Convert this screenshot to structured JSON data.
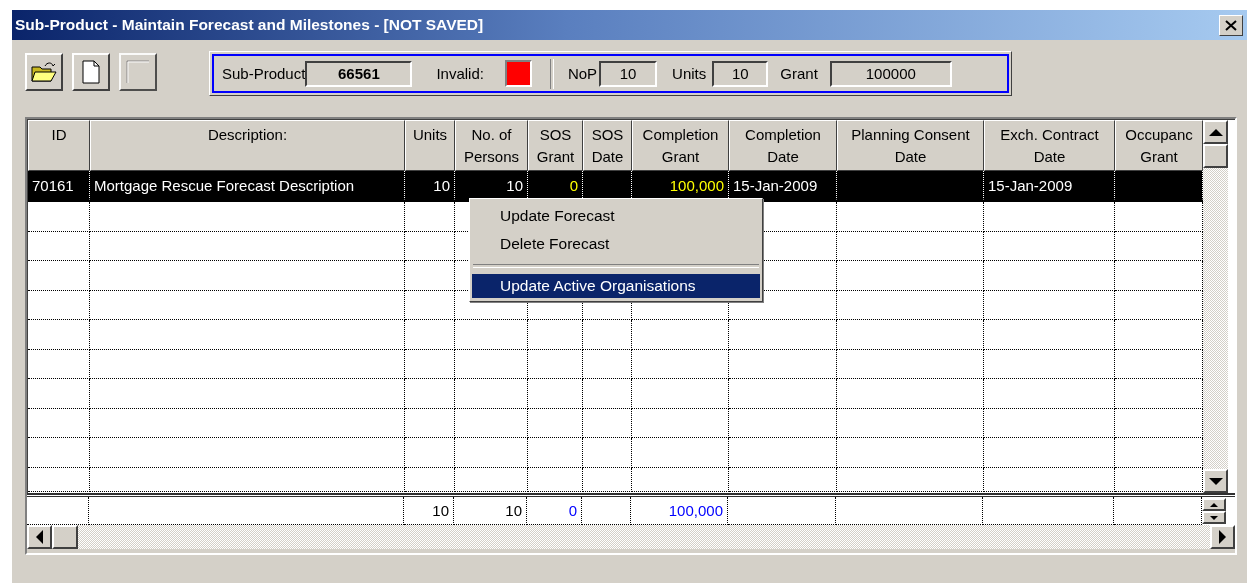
{
  "window": {
    "title": "Sub-Product - Maintain Forecast and Milestones - [NOT SAVED]"
  },
  "toolbar": [
    {
      "kind": "open",
      "disabled": false
    },
    {
      "kind": "new",
      "disabled": false
    },
    {
      "kind": "blank",
      "disabled": true
    }
  ],
  "summary": {
    "sub_product": {
      "label": "Sub-Product",
      "value": "66561"
    },
    "invalid": {
      "label": "Invalid:",
      "color": "#ff0000"
    },
    "nop": {
      "label": "NoP",
      "value": "10"
    },
    "units": {
      "label": "Units",
      "value": "10"
    },
    "grant": {
      "label": "Grant",
      "value": "100000"
    }
  },
  "table": {
    "columns": [
      {
        "label": "ID"
      },
      {
        "label": "Description:"
      },
      {
        "label": "Units"
      },
      {
        "label": "No. of Persons"
      },
      {
        "label": "SOS Grant"
      },
      {
        "label": "SOS Date"
      },
      {
        "label": "Completion Grant"
      },
      {
        "label": "Completion Date"
      },
      {
        "label": "Planning Consent Date"
      },
      {
        "label": "Exch. Contract Date"
      },
      {
        "label": "Occupanc Grant"
      }
    ],
    "rows": [
      {
        "selected": true,
        "cells": [
          {
            "text": "70161",
            "kind": "text"
          },
          {
            "text": "Mortgage Rescue Forecast Description",
            "kind": "text"
          },
          {
            "text": "10",
            "kind": "number"
          },
          {
            "text": "10",
            "kind": "number"
          },
          {
            "text": "0",
            "kind": "money"
          },
          {
            "kind": "text"
          },
          {
            "text": "100,000",
            "kind": "money"
          },
          {
            "text": "15-Jan-2009",
            "kind": "text"
          },
          {
            "kind": "text"
          },
          {
            "text": "15-Jan-2009",
            "kind": "text"
          },
          {
            "kind": "text"
          }
        ]
      }
    ],
    "totals": [
      {
        "kind": "text"
      },
      {
        "kind": "text"
      },
      {
        "text": "10",
        "kind": "number"
      },
      {
        "text": "10",
        "kind": "number"
      },
      {
        "text": "0",
        "kind": "money"
      },
      {
        "kind": "text"
      },
      {
        "text": "100,000",
        "kind": "money"
      },
      {
        "kind": "text"
      },
      {
        "kind": "text"
      },
      {
        "kind": "text"
      },
      {
        "kind": "text"
      }
    ]
  },
  "context_menu": [
    {
      "label": "Update Forecast",
      "selected": false,
      "separator_before": false
    },
    {
      "label": "Delete Forecast",
      "selected": false,
      "separator_before": false
    },
    {
      "label": "Update Active Organisations",
      "selected": true,
      "separator_before": true
    }
  ]
}
